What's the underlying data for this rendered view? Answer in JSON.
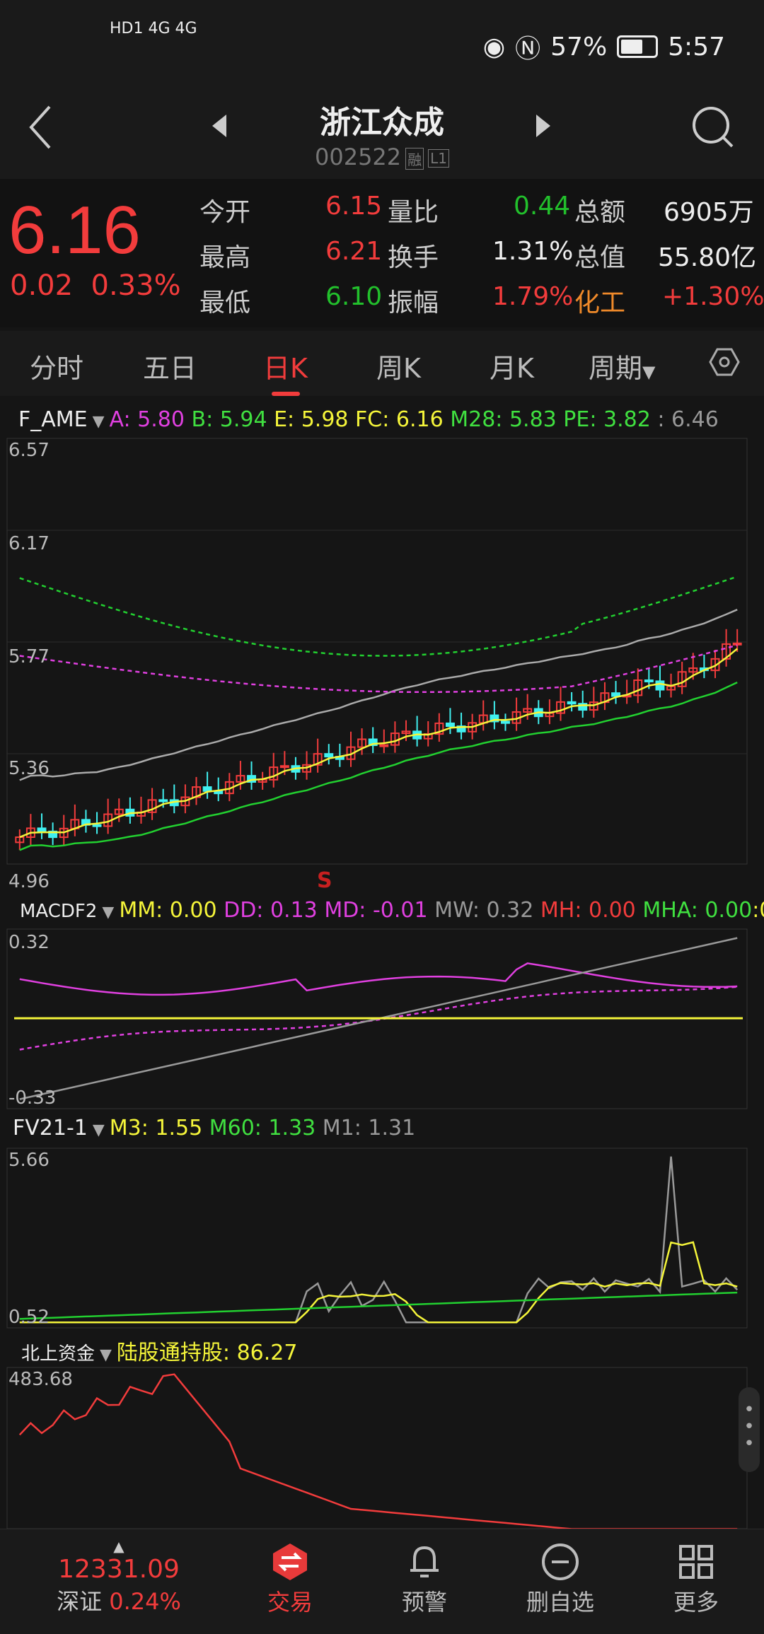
{
  "status": {
    "left": "HD1 4G 4G",
    "battery": "57%",
    "time": "5:57"
  },
  "header": {
    "title": "浙江众成",
    "code": "002522",
    "tag1": "融",
    "tag2": "L1"
  },
  "quote": {
    "price": "6.16",
    "change": "0.02",
    "change_pct": "0.33%",
    "rows": [
      {
        "l1": "今开",
        "v1": "6.15",
        "l2": "量比",
        "v2": "0.44",
        "l3": "总额",
        "v3": "6905万"
      },
      {
        "l1": "最高",
        "v1": "6.21",
        "l2": "换手",
        "v2": "1.31%",
        "l3": "总值",
        "v3": "55.80亿"
      },
      {
        "l1": "最低",
        "v1": "6.10",
        "l2": "振幅",
        "v2": "1.79%",
        "l3": "化工",
        "v3": "+1.30%"
      }
    ]
  },
  "tabs": [
    "分时",
    "五日",
    "日K",
    "周K",
    "月K",
    "周期"
  ],
  "indicators": {
    "main": {
      "name": "F_AME",
      "A": "A: 5.80",
      "B": "B: 5.94",
      "E": "E: 5.98",
      "FC": "FC: 6.16",
      "M28": "M28: 5.83",
      "PE": "PE: 3.82",
      "last": ": 6.46"
    },
    "main_axis": [
      "6.57",
      "6.17",
      "5.77",
      "5.36",
      "4.96"
    ],
    "marker": "S",
    "macd": {
      "name": "MACDF2",
      "MM": "MM: 0.00",
      "DD": "DD: 0.13",
      "MD": "MD: -0.01",
      "MW": "MW: 0.32",
      "MH": "MH: 0.00",
      "MHA": "MHA: 0.00",
      "extra": ":0"
    },
    "macd_axis": [
      "0.32",
      "-0.33"
    ],
    "fv": {
      "name": "FV21-1",
      "M3": "M3: 1.55",
      "M60": "M60: 1.33",
      "M1": "M1: 1.31"
    },
    "fv_axis": [
      "5.66",
      "0.52"
    ],
    "north": {
      "name": "北上资金",
      "value": "陆股通持股: 86.27"
    },
    "north_axis": [
      "483.68"
    ]
  },
  "nav": {
    "index_value": "12331.09",
    "index_name": "深证",
    "index_pct": "0.24%",
    "items": [
      "交易",
      "预警",
      "删自选",
      "更多"
    ]
  },
  "colors": {
    "up": "#f23c3c",
    "down": "#22c02c",
    "yellow": "#f5f53a",
    "magenta": "#e040e0",
    "cyan": "#40f0f0"
  }
}
